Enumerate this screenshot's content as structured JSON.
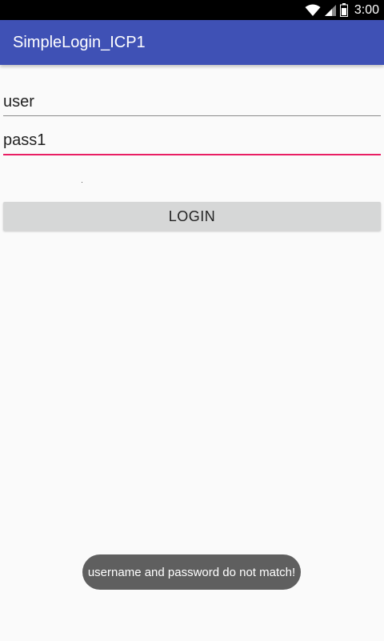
{
  "status_bar": {
    "time": "3:00",
    "icons": [
      "wifi-icon",
      "cell-signal-icon",
      "battery-icon"
    ]
  },
  "app_bar": {
    "title": "SimpleLogin_ICP1",
    "color": "#3f51b5"
  },
  "form": {
    "username_value": "user",
    "password_value": "pass1",
    "focused_underline_color": "#e91e63"
  },
  "login_button": {
    "label": "LOGIN"
  },
  "toast": {
    "message": "username and password do not match!"
  }
}
